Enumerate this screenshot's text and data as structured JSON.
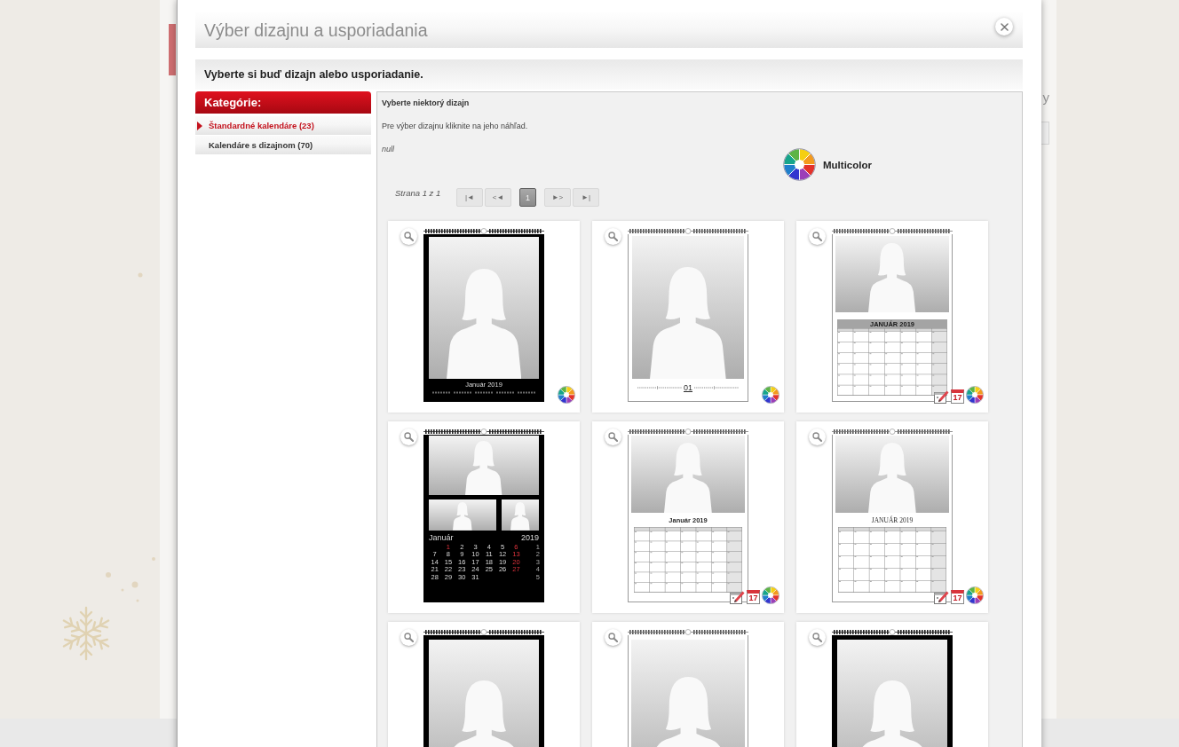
{
  "background_page": {
    "fragment_text": "y"
  },
  "dialog": {
    "title": "Výber dizajnu a usporiadania",
    "instruction": "Vyberte si buď dizajn alebo usporiadanie."
  },
  "sidebar": {
    "heading": "Kategórie:",
    "items": [
      {
        "label": "Štandardné kalendáre (23)",
        "selected": true
      },
      {
        "label": "Kalendáre s dizajnom (70)",
        "selected": false
      }
    ]
  },
  "content": {
    "heading": "Vyberte niektorý dizajn",
    "hint": "Pre výber dizajnu kliknite na jeho náhľad.",
    "note": "null",
    "filter": {
      "label": "Multicolor"
    },
    "pagination": {
      "label": "Strana 1 z 1",
      "buttons": [
        {
          "kind": "nav",
          "label": "|◄",
          "disabled": true,
          "selected": false
        },
        {
          "kind": "nav",
          "label": "<◄",
          "disabled": true,
          "selected": false
        },
        {
          "kind": "page",
          "label": "1",
          "disabled": false,
          "selected": true
        },
        {
          "kind": "nav",
          "label": "►>",
          "disabled": true,
          "selected": false
        },
        {
          "kind": "nav",
          "label": "►|",
          "disabled": true,
          "selected": false
        }
      ]
    },
    "designs": [
      {
        "kind": "photo_caption",
        "dark": true,
        "caption": "Január 2019",
        "badges": [
          {
            "kind": "multicolor"
          }
        ]
      },
      {
        "kind": "photo_strip",
        "dark": false,
        "caption": "01",
        "badges": [
          {
            "kind": "multicolor"
          }
        ]
      },
      {
        "kind": "photo_table",
        "dark": false,
        "caption": "JANUÁR 2019",
        "badges": [
          {
            "kind": "edit"
          },
          {
            "kind": "date",
            "text": "17"
          },
          {
            "kind": "multicolor"
          }
        ]
      },
      {
        "kind": "collage",
        "dark": true,
        "month": "Január",
        "year": "2019",
        "weeks": [
          [
            {
              "d": "1",
              "holiday": true
            },
            {
              "d": "2",
              "holiday": false
            },
            {
              "d": "3",
              "holiday": false
            },
            {
              "d": "4",
              "holiday": false
            },
            {
              "d": "5",
              "holiday": false
            },
            {
              "d": "6",
              "holiday": true
            }
          ],
          [
            {
              "d": "7",
              "holiday": false
            },
            {
              "d": "8",
              "holiday": false
            },
            {
              "d": "9",
              "holiday": false
            },
            {
              "d": "10",
              "holiday": false
            },
            {
              "d": "11",
              "holiday": false
            },
            {
              "d": "12",
              "holiday": false
            },
            {
              "d": "13",
              "holiday": true
            }
          ],
          [
            {
              "d": "14",
              "holiday": false
            },
            {
              "d": "15",
              "holiday": false
            },
            {
              "d": "16",
              "holiday": false
            },
            {
              "d": "17",
              "holiday": false
            },
            {
              "d": "18",
              "holiday": false
            },
            {
              "d": "19",
              "holiday": false
            },
            {
              "d": "20",
              "holiday": true
            }
          ],
          [
            {
              "d": "21",
              "holiday": false
            },
            {
              "d": "22",
              "holiday": false
            },
            {
              "d": "23",
              "holiday": false
            },
            {
              "d": "24",
              "holiday": false
            },
            {
              "d": "25",
              "holiday": false
            },
            {
              "d": "26",
              "holiday": false
            },
            {
              "d": "27",
              "holiday": true
            }
          ],
          [
            {
              "d": "28",
              "holiday": false
            },
            {
              "d": "29",
              "holiday": false
            },
            {
              "d": "30",
              "holiday": false
            },
            {
              "d": "31",
              "holiday": false
            }
          ]
        ],
        "week_numbers": [
          "1",
          "2",
          "3",
          "4",
          "5"
        ]
      },
      {
        "kind": "photo_grid",
        "dark": false,
        "caption": "Január 2019",
        "badges": [
          {
            "kind": "edit"
          },
          {
            "kind": "date",
            "text": "17"
          },
          {
            "kind": "multicolor"
          }
        ]
      },
      {
        "kind": "photo_grid_classic",
        "dark": false,
        "caption": "JANUÁR 2019",
        "badges": [
          {
            "kind": "edit"
          },
          {
            "kind": "date",
            "text": "17"
          },
          {
            "kind": "multicolor"
          }
        ]
      },
      {
        "kind": "photo",
        "dark": true
      },
      {
        "kind": "photo",
        "dark": false
      },
      {
        "kind": "photo",
        "dark": true
      }
    ]
  }
}
